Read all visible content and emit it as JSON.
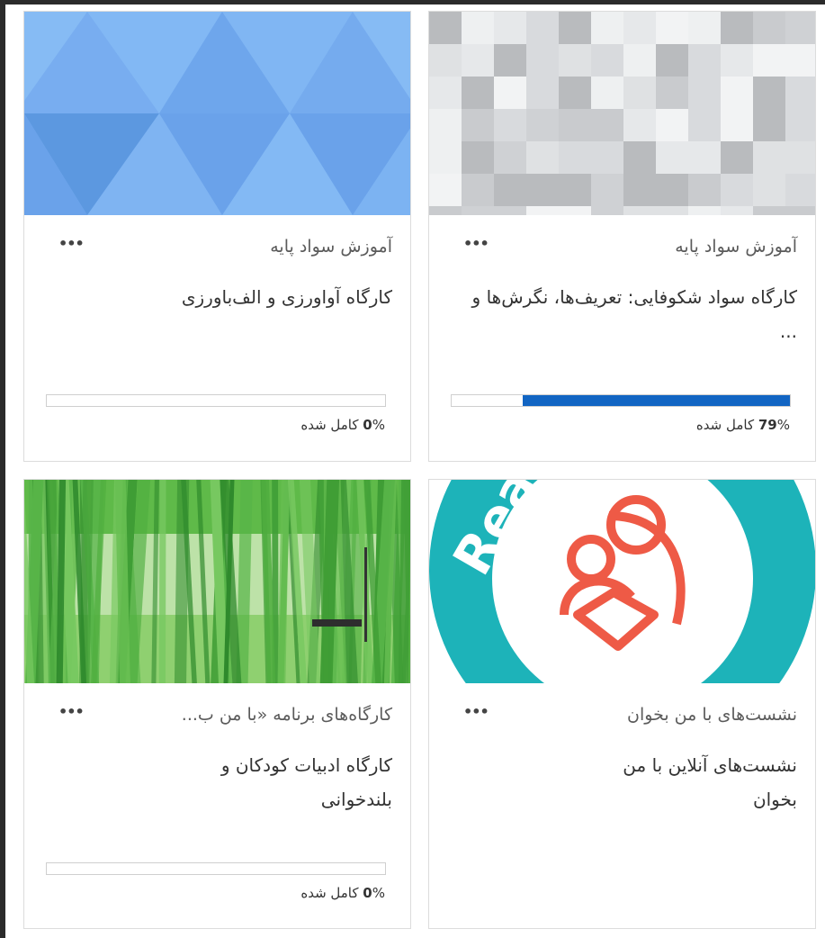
{
  "courses": [
    {
      "category": "آموزش سواد پایه",
      "title": "کارگاه سواد شکوفایی: تعریف‌ها، نگرش‌ها و ...",
      "menu_icon": "ellipsis-icon",
      "progress_value": "79",
      "progress_fraction": 0.79,
      "progress_suffix": "% کامل شده"
    },
    {
      "category": "آموزش سواد پایه",
      "title": "کارگاه آواورزی و الف‌باورزی",
      "menu_icon": "ellipsis-icon",
      "progress_value": "0",
      "progress_fraction": 0,
      "progress_suffix": "% کامل شده"
    },
    {
      "category": "نشست‌های با من بخوان",
      "title": "نشست‌های آنلاین با من بخوان",
      "menu_icon": "ellipsis-icon",
      "image_text": "Read with Me"
    },
    {
      "category": "کارگاه‌های برنامه «با من ب...",
      "title": "کارگاه ادبیات کودکان و بلندخوانی",
      "menu_icon": "ellipsis-icon",
      "progress_value": "0",
      "progress_fraction": 0,
      "progress_suffix": "% کامل شده"
    }
  ],
  "colors": {
    "progress_fill": "#1265c3",
    "triangle_blue": "#7cb3f2",
    "teal": "#1db3b9",
    "coral": "#ee5a46"
  }
}
